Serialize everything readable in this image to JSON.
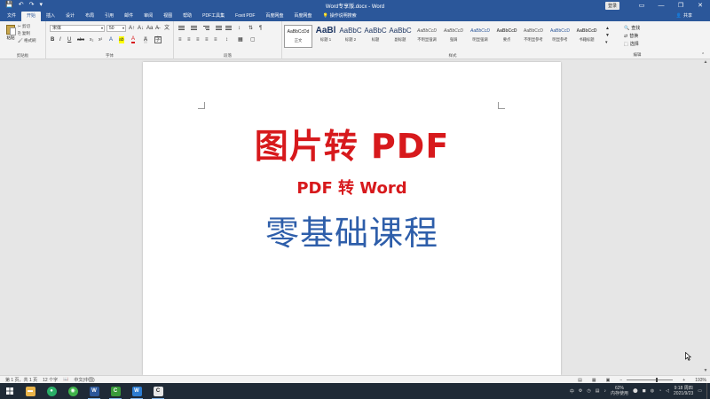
{
  "window": {
    "title": "Word专享版.docx - Word",
    "login_label": "登录",
    "controls": [
      "—",
      "❐",
      "✕"
    ]
  },
  "qat": [
    "💾",
    "↶",
    "↷",
    "▾"
  ],
  "tabs": [
    "文件",
    "开始",
    "插入",
    "设计",
    "布局",
    "引用",
    "邮件",
    "审阅",
    "视图",
    "帮助",
    "PDF工具集",
    "Foxit PDF",
    "百度网盘",
    "百度网盘"
  ],
  "tell_me": "操作说明搜索",
  "share": "共享",
  "ribbon": {
    "clipboard": {
      "paste": "粘贴",
      "cut": "✂ 剪切",
      "copy": "⎘ 复制",
      "format_painter": "🖌 格式刷",
      "label": "剪贴板"
    },
    "font": {
      "font_name": "宋体",
      "font_size": "50",
      "label": "字体",
      "buttons_row1": [
        "A↑",
        "A↓",
        "Aa",
        "A̶",
        "文"
      ],
      "buttons_row2": [
        "B",
        "I",
        "U",
        "abc",
        "x₂",
        "x²",
        "A",
        "ab",
        "A",
        "A",
        "字"
      ]
    },
    "paragraph": {
      "label": "段落",
      "buttons_row2": [
        "≡",
        "≡",
        "≡",
        "≡",
        "≡",
        "↕",
        "▦",
        "▢"
      ]
    },
    "styles": {
      "label": "样式",
      "items": [
        {
          "preview": "AaBbCcDd",
          "name": "正文"
        },
        {
          "preview": "AaBl",
          "name": "标题 1"
        },
        {
          "preview": "AaBbC",
          "name": "标题 2"
        },
        {
          "preview": "AaBbC",
          "name": "标题"
        },
        {
          "preview": "AaBbC",
          "name": "副标题"
        },
        {
          "preview": "AaBbCcD",
          "name": "不明显强调"
        },
        {
          "preview": "AaBbCcD",
          "name": "强调"
        },
        {
          "preview": "AaBbCcD",
          "name": "明显强调"
        },
        {
          "preview": "AaBbCcD",
          "name": "要点"
        },
        {
          "preview": "AaBbCcD",
          "name": "不明显参考"
        },
        {
          "preview": "AaBbCcD",
          "name": "明显参考"
        },
        {
          "preview": "AaBbCcD",
          "name": "书籍标题"
        }
      ]
    },
    "editing": {
      "find": "查找",
      "replace": "替换",
      "select": "选择",
      "label": "编辑"
    }
  },
  "document": {
    "line1": "图片转 PDF",
    "line2": "PDF 转 Word",
    "line3": "零基础课程",
    "colors": {
      "red": "#d7191c",
      "blue": "#2e5eaa"
    }
  },
  "status": {
    "page": "第 1 页，共 1 页",
    "words": "12 个字",
    "language": "中文(中国)",
    "zoom": "193%",
    "zoom_fraction": 0.62
  },
  "taskbar": {
    "apps": [
      {
        "name": "file-explorer",
        "glyph": "▬",
        "color": "#e8b34a"
      },
      {
        "name": "wechat",
        "glyph": "●",
        "color": "#2aae67"
      },
      {
        "name": "360",
        "glyph": "◉",
        "color": "#3fb24a"
      },
      {
        "name": "word",
        "glyph": "W",
        "color": "#2b579a"
      },
      {
        "name": "camtasia",
        "glyph": "C",
        "color": "#3a9a3a"
      },
      {
        "name": "pdf-tool",
        "glyph": "W",
        "color": "#2d7dd2"
      },
      {
        "name": "recorder",
        "glyph": "C",
        "color": "#e6e6e6"
      }
    ],
    "tray": {
      "ime": "中",
      "cpu": "62%",
      "cpu_label": "内存使用",
      "time": "9:18 周四",
      "date": "2021/9/23"
    }
  }
}
